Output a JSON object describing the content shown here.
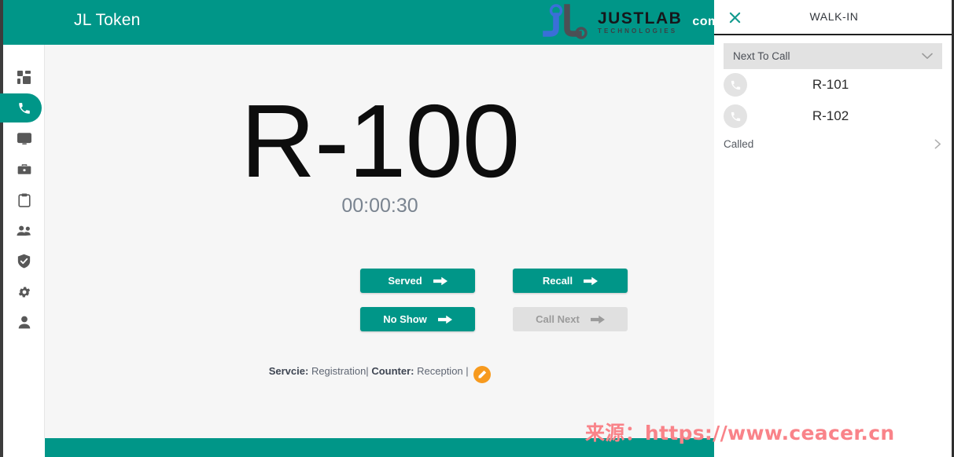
{
  "header": {
    "title": "JL Token",
    "brand_name": "JUSTLAB",
    "brand_sub": "TECHNOLOGIES",
    "brand_suffix": "com",
    "accent_color": "#009688"
  },
  "sidebar": {
    "items": [
      {
        "name": "dashboard",
        "icon": "grid-icon",
        "active": false
      },
      {
        "name": "calls",
        "icon": "phone-icon",
        "active": true
      },
      {
        "name": "display",
        "icon": "monitor-icon",
        "active": false
      },
      {
        "name": "services",
        "icon": "briefcase-icon",
        "active": false
      },
      {
        "name": "reports",
        "icon": "clipboard-icon",
        "active": false
      },
      {
        "name": "users",
        "icon": "users-icon",
        "active": false
      },
      {
        "name": "roles",
        "icon": "shield-icon",
        "active": false
      },
      {
        "name": "settings",
        "icon": "gear-icon",
        "active": false
      },
      {
        "name": "profile",
        "icon": "person-icon",
        "active": false
      }
    ]
  },
  "main": {
    "token": "R-100",
    "timer": "00:00:30",
    "buttons": [
      {
        "label": "Served",
        "name": "served-button",
        "disabled": false
      },
      {
        "label": "Recall",
        "name": "recall-button",
        "disabled": false
      },
      {
        "label": "No Show",
        "name": "no-show-button",
        "disabled": false
      },
      {
        "label": "Call Next",
        "name": "call-next-button",
        "disabled": true
      }
    ],
    "meta": {
      "service_label": "Servcie:",
      "service_value": "Registration|",
      "counter_label": "Counter:",
      "counter_value": "Reception |",
      "edit_icon": "pencil-icon",
      "edit_color": "#f79a1e"
    }
  },
  "panel": {
    "close_icon": "close-icon",
    "title": "WALK-IN",
    "select": {
      "value": "Next To Call",
      "chevron_icon": "chevron-down-icon"
    },
    "queue": [
      {
        "token": "R-101",
        "icon": "phone-icon"
      },
      {
        "token": "R-102",
        "icon": "phone-icon"
      }
    ],
    "called": {
      "label": "Called",
      "chevron_icon": "chevron-right-icon"
    }
  },
  "watermark": {
    "text": "来源：https://www.ceacer.cn",
    "color": "#f98389"
  }
}
